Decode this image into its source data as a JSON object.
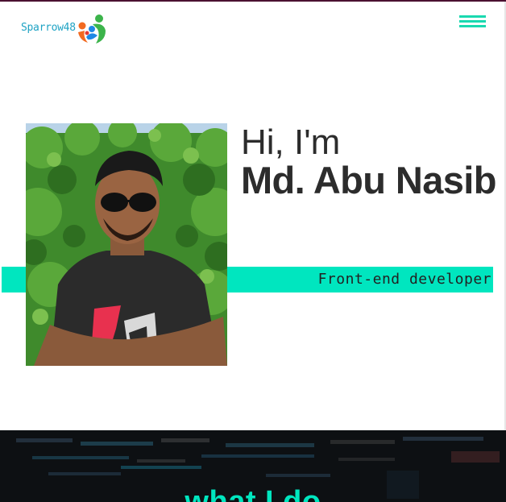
{
  "header": {
    "logo_text": "Sparrow48",
    "logo_icon": "people-logo-icon",
    "menu_icon": "hamburger-menu-icon"
  },
  "hero": {
    "greeting": "Hi, I'm",
    "name": "Md. Abu Nasib",
    "role": "Front-end developer",
    "photo_alt": "Md. Abu Nasib"
  },
  "section": {
    "title": "what I do"
  },
  "colors": {
    "accent": "#00e6bf",
    "logo_text": "#1fa3c4",
    "text": "#2c2c2c",
    "dark_bg": "#0e1114"
  }
}
